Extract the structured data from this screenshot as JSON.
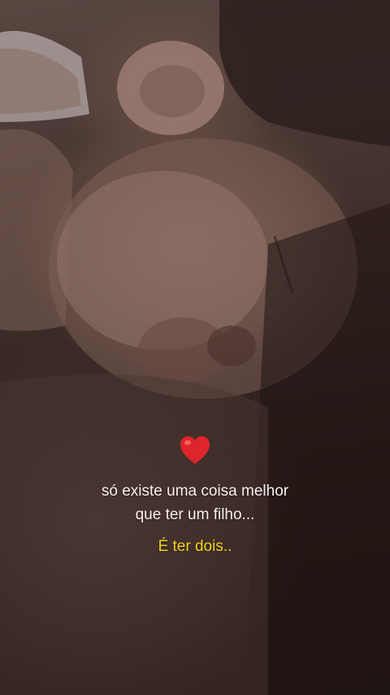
{
  "story": {
    "icon": "heart-icon",
    "lines": [
      "só existe uma coisa melhor",
      "que ter um filho..."
    ],
    "highlight": "É ter dois.."
  },
  "colors": {
    "text": "#f4f0ee",
    "highlight": "#f2d21c",
    "heart": "#e0242b"
  }
}
